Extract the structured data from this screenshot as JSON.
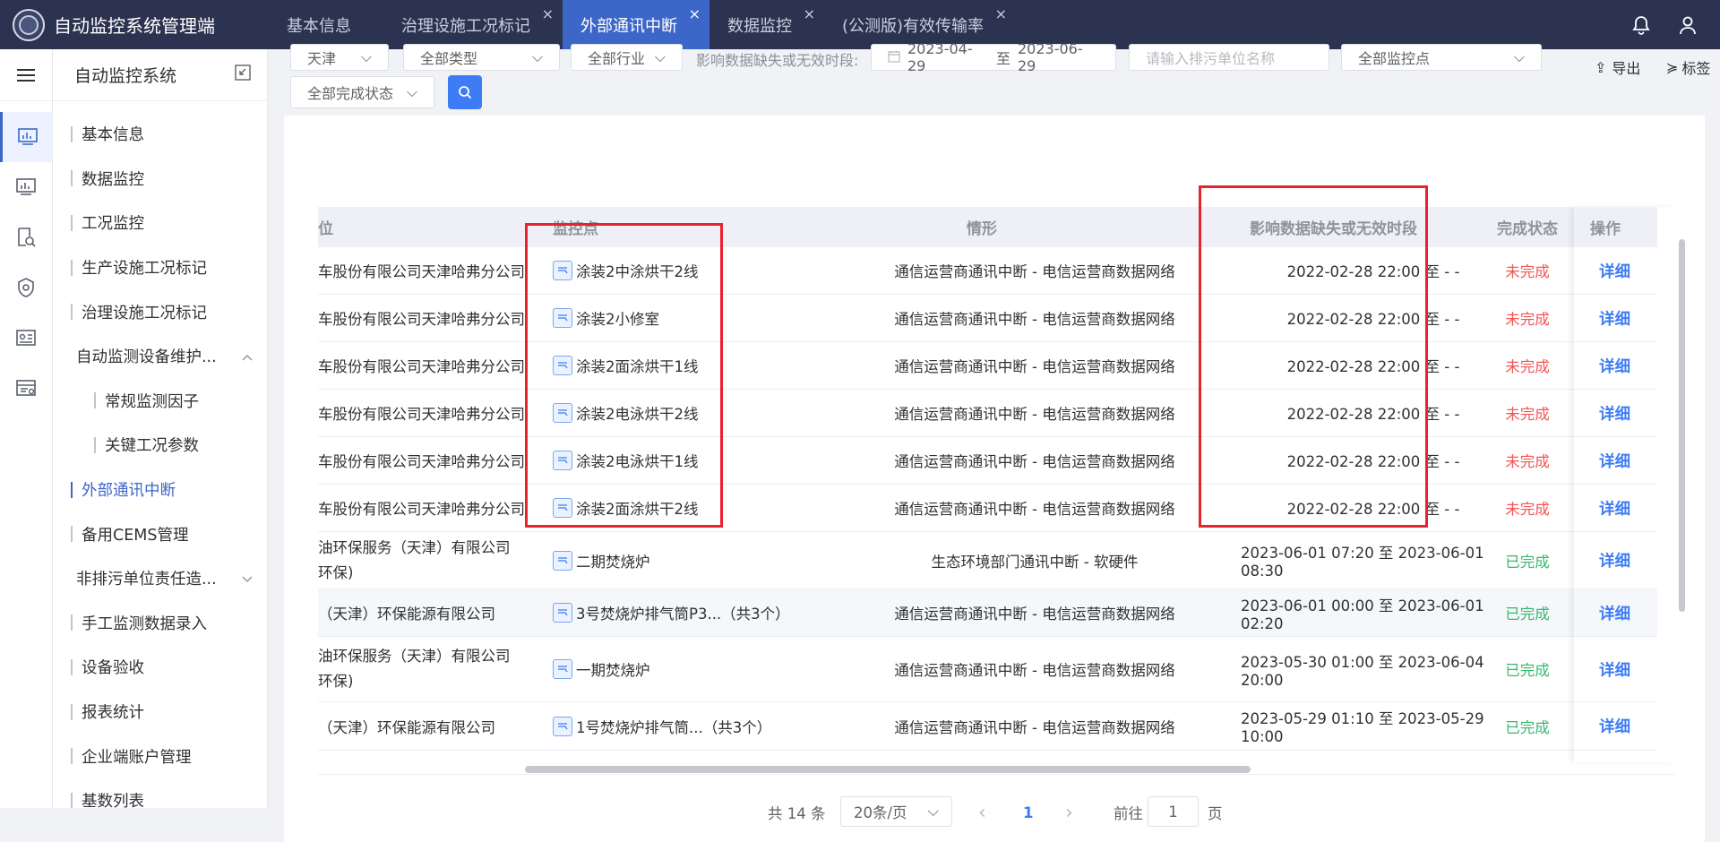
{
  "header": {
    "app_title": "自动监控系统管理端",
    "tabs": [
      {
        "label": "基本信息",
        "closable": false
      },
      {
        "label": "治理设施工况标记",
        "closable": true
      },
      {
        "label": "外部通讯中断",
        "closable": true,
        "active": true
      },
      {
        "label": "数据监控",
        "closable": true
      },
      {
        "label": "(公测版)有效传输率",
        "closable": true
      }
    ],
    "close_glyph": "×"
  },
  "sidebar": {
    "title": "自动监控系统",
    "items": [
      {
        "label": "基本信息",
        "type": "item"
      },
      {
        "label": "数据监控",
        "type": "item"
      },
      {
        "label": "工况监控",
        "type": "item"
      },
      {
        "label": "生产设施工况标记",
        "type": "item"
      },
      {
        "label": "治理设施工况标记",
        "type": "item"
      },
      {
        "label": "自动监测设备维护...",
        "type": "group-open"
      },
      {
        "label": "常规监测因子",
        "type": "sub"
      },
      {
        "label": "关键工况参数",
        "type": "sub"
      },
      {
        "label": "外部通讯中断",
        "type": "item",
        "active": true
      },
      {
        "label": "备用CEMS管理",
        "type": "item"
      },
      {
        "label": "非排污单位责任造...",
        "type": "group-closed"
      },
      {
        "label": "手工监测数据录入",
        "type": "item"
      },
      {
        "label": "设备验收",
        "type": "item"
      },
      {
        "label": "报表统计",
        "type": "item"
      },
      {
        "label": "企业端账户管理",
        "type": "item"
      },
      {
        "label": "基数列表",
        "type": "item"
      }
    ]
  },
  "filters": {
    "region": "天津",
    "type": "全部类型",
    "industry": "全部行业",
    "period_label": "影响数据缺失或无效时段:",
    "date_start": "2023-04-29",
    "date_sep": "至",
    "date_end": "2023-06-29",
    "company_placeholder": "请输入排污单位名称",
    "monitor_point": "全部监控点",
    "completion": "全部完成状态"
  },
  "toolbar": {
    "export_label": "导出",
    "tag_label": "标签"
  },
  "table": {
    "columns": [
      "位",
      "监控点",
      "情形",
      "影响数据缺失或无效时段",
      "完成状态",
      "操作"
    ],
    "rows": [
      {
        "company": "车股份有限公司天津哈弗分公司",
        "point": "涂装2中涂烘干2线",
        "situation": "通信运营商通讯中断 - 电信运营商数据网络",
        "period": "2022-02-28 22:00 至 - -",
        "status": "未完成",
        "action": "详细"
      },
      {
        "company": "车股份有限公司天津哈弗分公司",
        "point": "涂装2小修室",
        "situation": "通信运营商通讯中断 - 电信运营商数据网络",
        "period": "2022-02-28 22:00 至 - -",
        "status": "未完成",
        "action": "详细"
      },
      {
        "company": "车股份有限公司天津哈弗分公司",
        "point": "涂装2面涂烘干1线",
        "situation": "通信运营商通讯中断 - 电信运营商数据网络",
        "period": "2022-02-28 22:00 至 - -",
        "status": "未完成",
        "action": "详细"
      },
      {
        "company": "车股份有限公司天津哈弗分公司",
        "point": "涂装2电泳烘干2线",
        "situation": "通信运营商通讯中断 - 电信运营商数据网络",
        "period": "2022-02-28 22:00 至 - -",
        "status": "未完成",
        "action": "详细"
      },
      {
        "company": "车股份有限公司天津哈弗分公司",
        "point": "涂装2电泳烘干1线",
        "situation": "通信运营商通讯中断 - 电信运营商数据网络",
        "period": "2022-02-28 22:00 至 - -",
        "status": "未完成",
        "action": "详细"
      },
      {
        "company": "车股份有限公司天津哈弗分公司",
        "point": "涂装2面涂烘干2线",
        "situation": "通信运营商通讯中断 - 电信运营商数据网络",
        "period": "2022-02-28 22:00 至 - -",
        "status": "未完成",
        "action": "详细"
      },
      {
        "company": "油环保服务（天津）有限公司",
        "company2": "环保)",
        "point": "二期焚烧炉",
        "situation": "生态环境部门通讯中断 - 软硬件",
        "period": "2023-06-01 07:20 至 2023-06-01 08:30",
        "status": "已完成",
        "action": "详细"
      },
      {
        "company": "（天津）环保能源有限公司",
        "point": "3号焚烧炉排气筒P3...（共3个）",
        "situation": "通信运营商通讯中断 - 电信运营商数据网络",
        "period": "2023-06-01 00:00 至 2023-06-01 02:20",
        "status": "已完成",
        "action": "详细"
      },
      {
        "company": "油环保服务（天津）有限公司",
        "company2": "环保)",
        "point": "一期焚烧炉",
        "situation": "通信运营商通讯中断 - 电信运营商数据网络",
        "period": "2023-05-30 01:00 至 2023-06-04 20:00",
        "status": "已完成",
        "action": "详细"
      },
      {
        "company": "（天津）环保能源有限公司",
        "point": "1号焚烧炉排气筒...（共3个）",
        "situation": "通信运营商通讯中断 - 电信运营商数据网络",
        "period": "2023-05-29 01:10 至 2023-05-29 10:00",
        "status": "已完成",
        "action": "详细"
      }
    ]
  },
  "pagination": {
    "total": "共 14 条",
    "page_size": "20条/页",
    "prev": "‹",
    "current_page": "1",
    "next": "›",
    "goto_label": "前往",
    "goto_value": "1",
    "page_unit": "页"
  },
  "colors": {
    "header_bg": "#2b3350",
    "active_tab": "#3d66c9",
    "accent": "#3d7cf5",
    "incomplete": "#f25555",
    "complete": "#36b96c",
    "highlight_box": "#e8232f"
  }
}
